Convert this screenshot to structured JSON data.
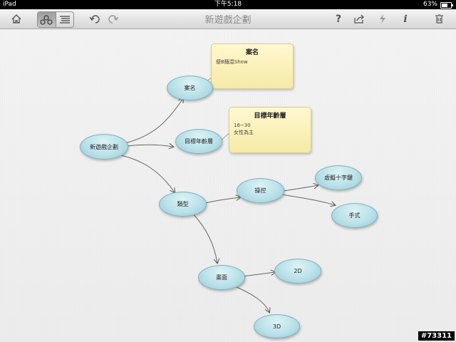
{
  "status": {
    "device": "iPad",
    "time": "下午5:18",
    "battery": "63%",
    "battery_level": 0.63
  },
  "toolbar": {
    "title": "新遊戲企劃",
    "help_label": "?",
    "info_label": "i"
  },
  "icons": [
    "home-icon",
    "mindmap-view-icon",
    "outline-view-icon",
    "undo-icon",
    "redo-icon",
    "help-icon",
    "share-icon",
    "lightning-icon",
    "info-icon",
    "trash-icon"
  ],
  "nodes": {
    "root": "新遊戲企劃",
    "case": "案名",
    "age": "目標年齡層",
    "type": "類型",
    "control": "操控",
    "dpad": "虛擬十字鍵",
    "gesture": "手式",
    "graphics": "畫面",
    "g2d": "2D",
    "g3d": "3D"
  },
  "notes": {
    "case_title": "案名",
    "case_body": "便B麵混Show",
    "age_title": "目標年齡層",
    "age_body": "16~30\n女性為主"
  },
  "watermark": "#73311"
}
